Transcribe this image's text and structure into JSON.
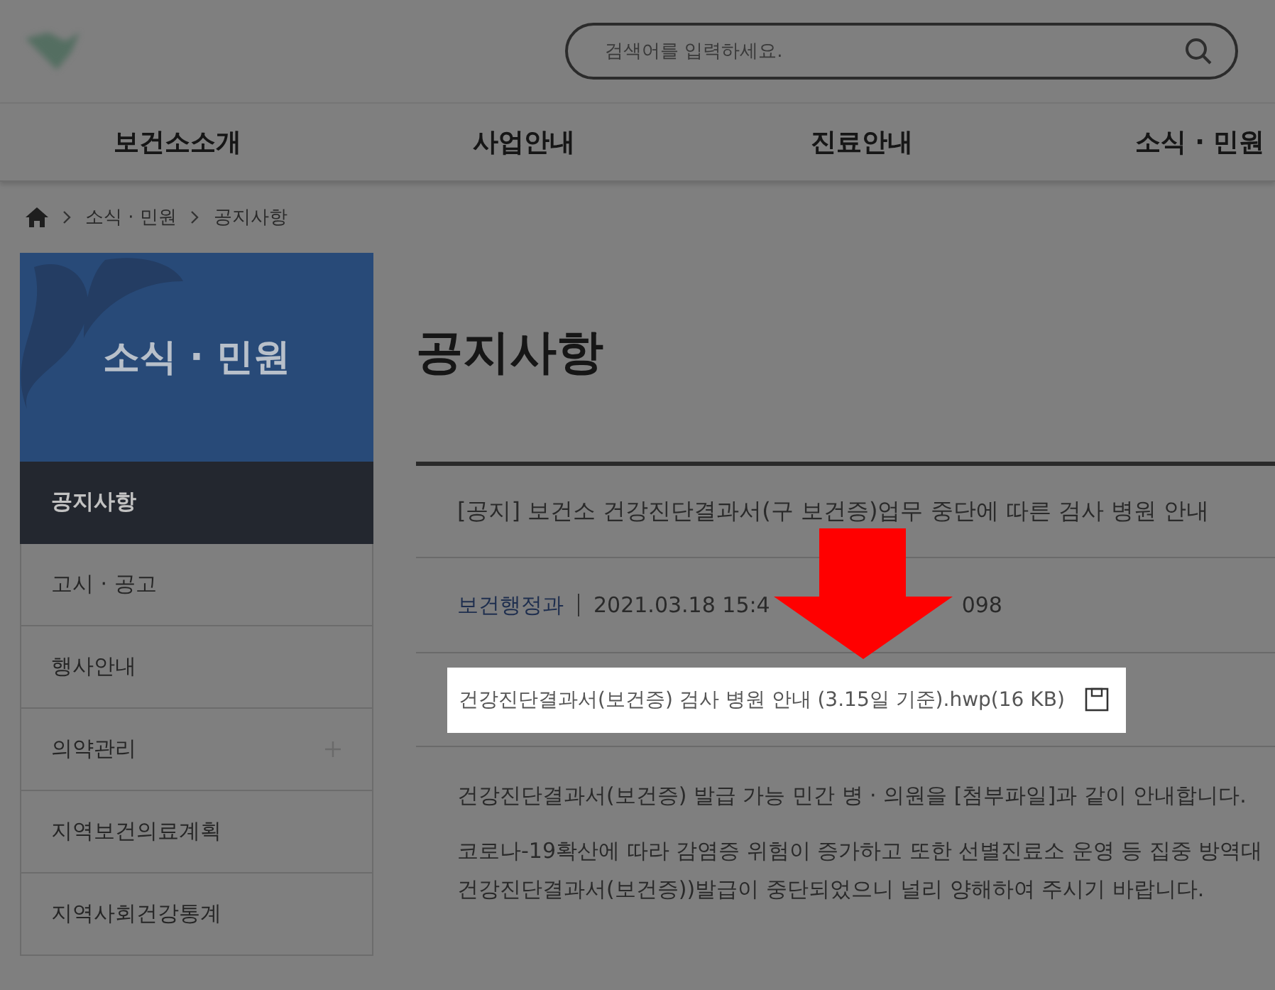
{
  "search": {
    "placeholder": "검색어를 입력하세요."
  },
  "nav": [
    "보건소소개",
    "사업안내",
    "진료안내",
    "소식 · 민원"
  ],
  "breadcrumb": [
    "소식 · 민원",
    "공지사항"
  ],
  "sidebar": {
    "title": "소식 · 민원",
    "items": [
      {
        "label": "공지사항",
        "selected": true,
        "expandable": false
      },
      {
        "label": "고시 · 공고",
        "selected": false,
        "expandable": false
      },
      {
        "label": "행사안내",
        "selected": false,
        "expandable": false
      },
      {
        "label": "의약관리",
        "selected": false,
        "expandable": true
      },
      {
        "label": "지역보건의료계획",
        "selected": false,
        "expandable": false
      },
      {
        "label": "지역사회건강통계",
        "selected": false,
        "expandable": false
      }
    ]
  },
  "page_title": "공지사항",
  "article": {
    "title": "[공지] 보건소 건강진단결과서(구 보건증)업무 중단에 따른 검사 병원 안내",
    "department": "보건행정과",
    "date": "2021.03.18 15:4",
    "views": "098",
    "attachment": {
      "name": "건강진단결과서(보건증) 검사 병원 안내 (3.15일 기준).hwp(16 KB)",
      "highlighted": true
    },
    "body": [
      [
        "건강진단결과서(보건증) 발급 가능 민간 병 · 의원을 [첨부파일]과 같이 안내합니다."
      ],
      [
        "코로나-19확산에 따라 감염증 위험이 증가하고 또한 선별진료소 운영 등 집중 방역대",
        "건강진단결과서(보건증))발급이 중단되었으니 널리 양해하여 주시기 바랍니다."
      ]
    ]
  }
}
